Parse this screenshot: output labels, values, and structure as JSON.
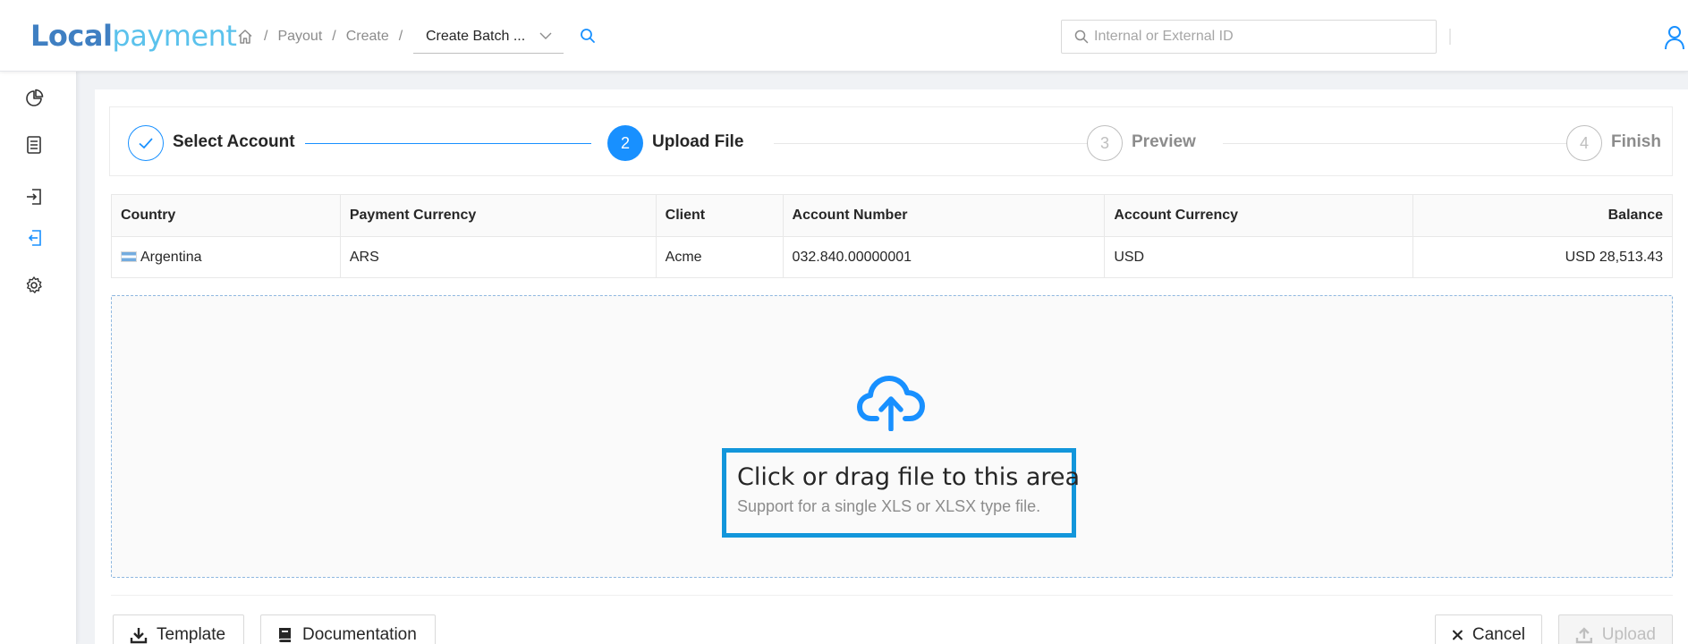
{
  "app": {
    "logo_part1": "Local",
    "logo_part2": "payment"
  },
  "breadcrumb": {
    "items": [
      "Payout",
      "Create"
    ],
    "current": "Create Batch ..."
  },
  "search": {
    "placeholder": "Internal or External ID"
  },
  "sidebar": {
    "items": [
      {
        "icon": "pie-chart-icon"
      },
      {
        "icon": "document-list-icon"
      },
      {
        "icon": "import-icon"
      },
      {
        "icon": "export-icon",
        "active": true
      },
      {
        "icon": "gear-icon"
      }
    ]
  },
  "steps": [
    {
      "number": "1",
      "label": "Select Account",
      "status": "done"
    },
    {
      "number": "2",
      "label": "Upload File",
      "status": "active"
    },
    {
      "number": "3",
      "label": "Preview",
      "status": "wait"
    },
    {
      "number": "4",
      "label": "Finish",
      "status": "wait"
    }
  ],
  "table": {
    "headers": [
      "Country",
      "Payment Currency",
      "Client",
      "Account Number",
      "Account Currency",
      "Balance"
    ],
    "rows": [
      [
        "Argentina",
        "ARS",
        "Acme",
        "032.840.00000001",
        "USD",
        "USD 28,513.43"
      ]
    ]
  },
  "dropzone": {
    "title": "Click or drag file to this area",
    "hint": "Support for a single XLS or XLSX type file."
  },
  "actions": {
    "template_label": "Template",
    "documentation_label": "Documentation",
    "cancel_label": "Cancel",
    "upload_label": "Upload"
  },
  "colors": {
    "primary": "#1890ff",
    "logo_dark": "#3f7fc2",
    "logo_light": "#5bc2ec",
    "highlight_border": "#1296db"
  }
}
